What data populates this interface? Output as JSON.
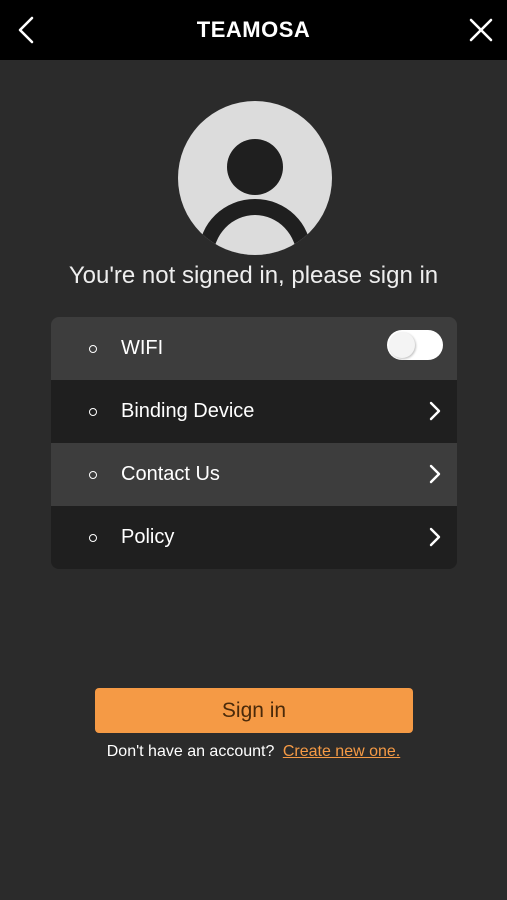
{
  "header": {
    "title": "TEAMOSA",
    "back_icon": "chevron-left-icon",
    "close_icon": "close-icon"
  },
  "profile": {
    "avatar_icon": "user-avatar-icon",
    "prompt": "You're not signed in, please sign in"
  },
  "menu": {
    "items": [
      {
        "label": "WIFI",
        "control": "toggle",
        "toggle_on": false
      },
      {
        "label": "Binding Device",
        "control": "chevron-right-icon"
      },
      {
        "label": "Contact Us",
        "control": "chevron-right-icon"
      },
      {
        "label": "Policy",
        "control": "chevron-right-icon"
      }
    ]
  },
  "auth": {
    "sign_in_label": "Sign in",
    "no_account_text": "Don't have an account?",
    "create_link_text": "Create new one."
  },
  "colors": {
    "background": "#2b2b2b",
    "titlebar": "#000000",
    "accent": "#f59a45",
    "row_light": "#3d3d3d",
    "row_dark": "#1f1f1f"
  }
}
